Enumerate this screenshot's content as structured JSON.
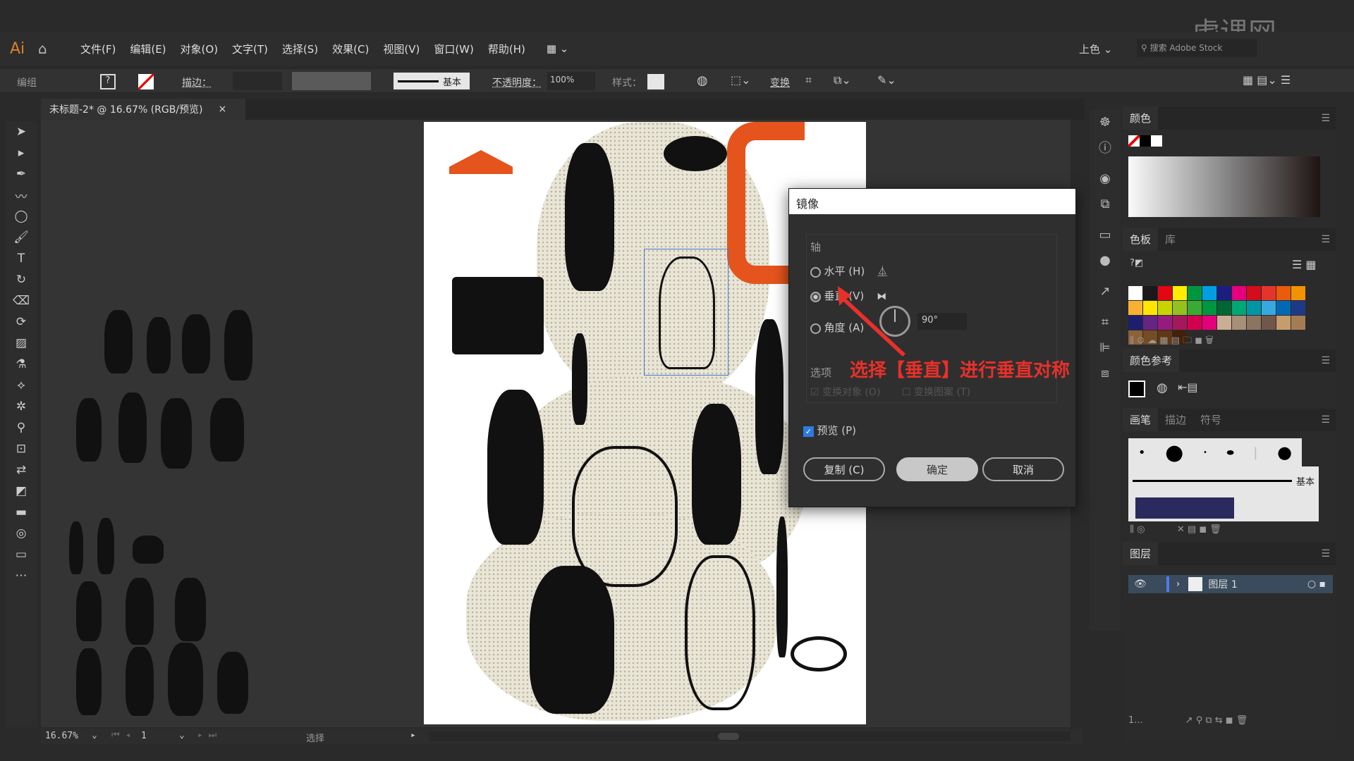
{
  "app": {
    "logo": "Ai",
    "watermark": "虎课网"
  },
  "menubar": {
    "items": [
      "文件(F)",
      "编辑(E)",
      "对象(O)",
      "文字(T)",
      "选择(S)",
      "效果(C)",
      "视图(V)",
      "窗口(W)",
      "帮助(H)"
    ],
    "workspace": "上色",
    "search_placeholder": "搜索 Adobe Stock"
  },
  "control": {
    "selection": "编组",
    "stroke_label": "描边：",
    "brush": "基本",
    "opacity_label": "不透明度：",
    "opacity": "100%",
    "style_label": "样式：",
    "transform": "变换"
  },
  "document_tab": {
    "title": "未标题-2* @ 16.67% (RGB/预览)",
    "close": "×"
  },
  "status": {
    "zoom": "16.67%",
    "artboard": "1",
    "tool": "选择"
  },
  "panels": {
    "color": {
      "title": "颜色"
    },
    "swatches": {
      "tabs": [
        "色板",
        "库"
      ]
    },
    "color_guide": {
      "title": "颜色参考"
    },
    "brushes": {
      "tabs": [
        "画笔",
        "描边",
        "符号"
      ],
      "basic": "基本"
    },
    "layers": {
      "title": "图层",
      "layer_name": "图层 1",
      "count": "1..."
    }
  },
  "swatch_colors": [
    "#ffffff",
    "#1a1a1a",
    "#e30613",
    "#ffed00",
    "#009640",
    "#009fe3",
    "#1d1d80",
    "#e6007e",
    "#d40c1c",
    "#e5352b",
    "#ea5b0c",
    "#f39200",
    "#f8b133",
    "#ffe500",
    "#c8d400",
    "#95c11f",
    "#3aaa35",
    "#009640",
    "#006633",
    "#00a775",
    "#0096a5",
    "#36a9e1",
    "#0069b4",
    "#1d3a8a",
    "#1e1e6e",
    "#662483",
    "#951b81",
    "#a3195b",
    "#d3004f",
    "#e2007a",
    "#c9ae93",
    "#a88f78",
    "#8c7461",
    "#70574a",
    "#c69c6d",
    "#a57c52",
    "#8c6239",
    "#754c24",
    "#603813",
    "#42210b"
  ],
  "dialog": {
    "title": "镜像",
    "axis_label": "轴",
    "horizontal": "水平 (H)",
    "vertical": "垂直 (V)",
    "angle": "角度 (A)",
    "angle_value": "90°",
    "options_label": "选项",
    "transform_objects": "变换对象 (O)",
    "transform_patterns": "变换图案 (T)",
    "preview": "预览 (P)",
    "copy": "复制 (C)",
    "ok": "确定",
    "cancel": "取消",
    "selected_axis": "vertical",
    "preview_checked": true
  },
  "annotation": {
    "text": "选择【垂直】进行垂直对称",
    "color": "#e8302a"
  }
}
